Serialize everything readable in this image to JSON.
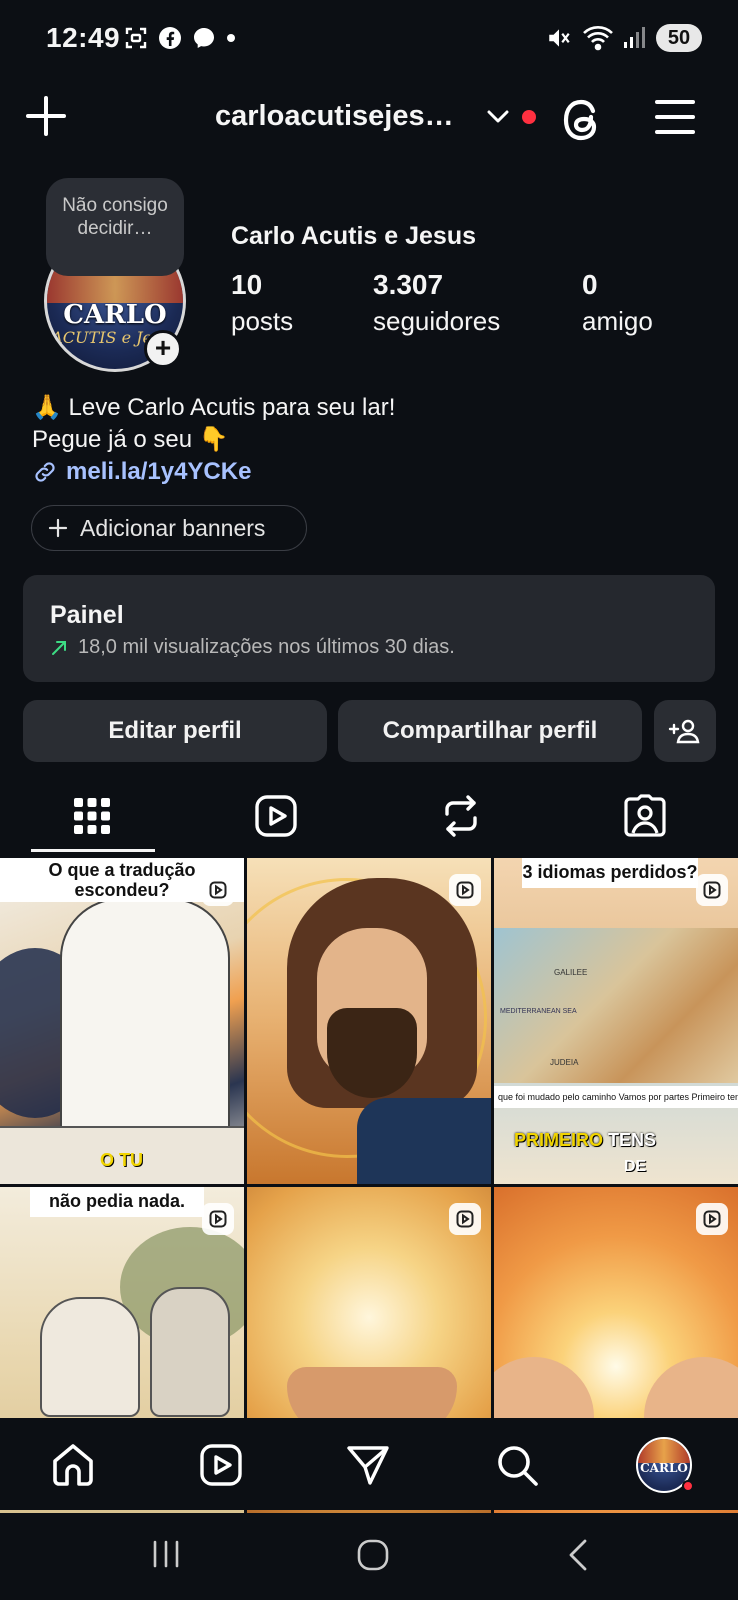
{
  "status_bar": {
    "time": "12:49",
    "battery": "50",
    "icons": [
      "screenshot-icon",
      "facebook-icon",
      "messenger-icon",
      "dot-icon",
      "mute-icon",
      "wifi-icon",
      "signal-icon"
    ]
  },
  "header": {
    "username": "carloacutisejes…"
  },
  "profile": {
    "note": "Não consigo decidir…",
    "avatar_title": "CARLO",
    "avatar_subtitle": "ACUTIS e Jesus",
    "name": "Carlo Acutis e Jesus",
    "stats": [
      {
        "value": "10",
        "label": "posts"
      },
      {
        "value": "3.307",
        "label": "seguidores"
      },
      {
        "value": "0",
        "label": "amigo"
      }
    ],
    "bio_line1": "🙏 Leve Carlo Acutis para seu lar!",
    "bio_line2": "Pegue já o seu 👇",
    "link": "meli.la/1y4YCKe",
    "add_banners": "Adicionar banners"
  },
  "panel": {
    "title": "Painel",
    "subtitle": "18,0 mil visualizações nos últimos 30 dias."
  },
  "actions": {
    "edit": "Editar perfil",
    "share": "Compartilhar perfil"
  },
  "tabs": [
    "grid-tab",
    "reels-tab",
    "reposts-tab",
    "tagged-tab"
  ],
  "posts": [
    {
      "caption": "O que a tradução escondeu?",
      "overlay": "O TU"
    },
    {
      "caption": "",
      "overlay": ""
    },
    {
      "caption": "3 idiomas perdidos?",
      "band": "que foi mudado pelo caminho Vamos por partes Primeiro tens de perceber por",
      "word": "PRIMEIRO",
      "word2": "TENS",
      "word3": "DE",
      "map_labels": [
        "GALILEE",
        "MEDITERRANEAN SEA",
        "JUDEIA"
      ]
    },
    {
      "caption": "não pedia nada."
    },
    {
      "caption": ""
    },
    {
      "caption": ""
    }
  ],
  "colors": {
    "background": "#0c0f14",
    "card": "#25282e",
    "button": "#2a2d33",
    "link": "#a8c2ff",
    "notification": "#ff3040",
    "trend": "#3ddc84"
  }
}
